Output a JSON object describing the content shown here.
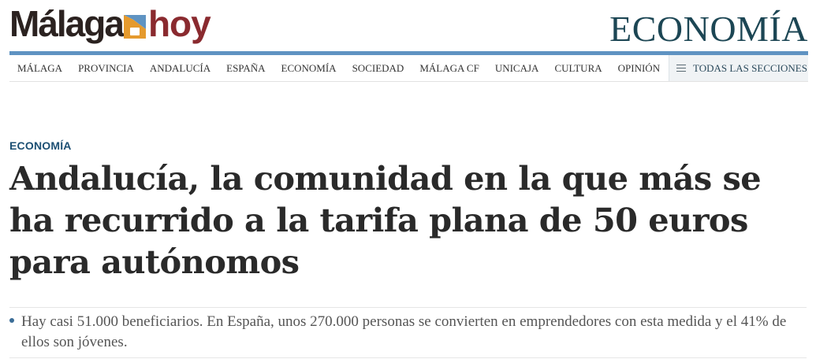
{
  "brand": {
    "name_part1": "Málaga",
    "name_part2": "hoy",
    "colors": {
      "dark": "#2b2220",
      "wine": "#8a2a2f",
      "mark_blue": "#5f93c2",
      "mark_orange": "#e59a2e"
    }
  },
  "section": {
    "title": "ECONOMÍA",
    "color": "#1c4654"
  },
  "nav": {
    "items": [
      {
        "label": "MÁLAGA"
      },
      {
        "label": "PROVINCIA"
      },
      {
        "label": "ANDALUCÍA"
      },
      {
        "label": "ESPAÑA"
      },
      {
        "label": "ECONOMÍA"
      },
      {
        "label": "SOCIEDAD"
      },
      {
        "label": "MÁLAGA CF"
      },
      {
        "label": "UNICAJA"
      },
      {
        "label": "CULTURA"
      },
      {
        "label": "OPINIÓN"
      }
    ],
    "all_sections": {
      "label": "TODAS LAS SECCIONES",
      "icon": "menu-icon"
    }
  },
  "article": {
    "kicker": "ECONOMÍA",
    "headline": "Andalucía, la comunidad en la que más se ha recurrido a la tarifa plana de 50 euros para autónomos",
    "subheadline": "Hay casi 51.000 beneficiarios. En España, unos 270.000 personas se convierten en emprendedores con esta medida y el 41% de ellos son jóvenes."
  }
}
